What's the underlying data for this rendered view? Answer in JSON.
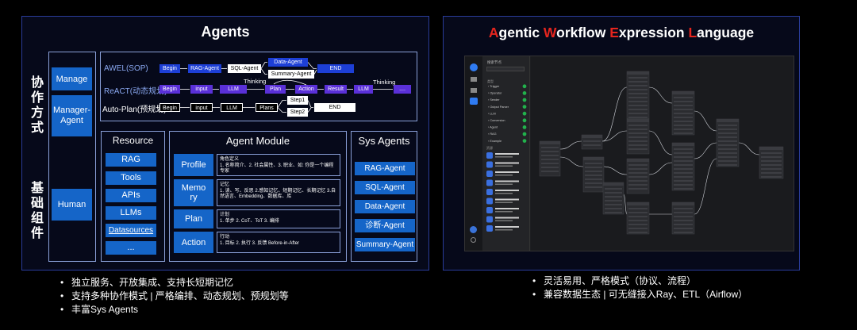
{
  "left": {
    "title": "Agents",
    "vertical_labels": {
      "collab": "协作方式",
      "base": "基础组件"
    },
    "collab_boxes": [
      "Manage",
      "Manager-Agent",
      "Human"
    ],
    "flows": {
      "awel": {
        "label": "AWEL(SOP)",
        "chips": [
          "Begin",
          "RAG-Agent",
          "SQL-Agent",
          "Data-Agent",
          "Summary-Agent",
          "END"
        ]
      },
      "react": {
        "label": "ReACT(动态规划)",
        "chips": [
          "Begin",
          "input",
          "LLM",
          "Plan",
          "Action",
          "Result",
          "LLM",
          "...."
        ],
        "thinking": "Thinking"
      },
      "autoplan": {
        "label": "Auto-Plan(预规划)",
        "chips": [
          "Begin",
          "input",
          "LLM",
          "Plans",
          "Step1",
          "Step2",
          "END"
        ]
      }
    },
    "resource": {
      "title": "Resource",
      "items": [
        "RAG",
        "Tools",
        "APIs",
        "LLMs",
        "Datasources",
        "..."
      ]
    },
    "agent_module": {
      "title": "Agent Module",
      "rows": [
        {
          "label": "Profile",
          "desc_title": "角色定义",
          "desc": "1. 名称简介、2. 社会属性、3. 职业、如: 你是一个编程专家"
        },
        {
          "label": "Memory",
          "desc_title": "记忆",
          "desc": "1. 读、写、反思 2.感知记忆、短期记忆、长期记忆 3.自然语言、Embedding、数据库、库"
        },
        {
          "label": "Plan",
          "desc_title": "计划",
          "desc": "1. 单步    2. CoT、ToT    3. 编排"
        },
        {
          "label": "Action",
          "desc_title": "行动",
          "desc": "1. 目标   2. 执行   3. 反馈 Before-in-After"
        }
      ]
    },
    "sys_agents": {
      "title": "Sys Agents",
      "items": [
        "RAG-Agent",
        "SQL-Agent",
        "Data-Agent",
        "诊断-Agent",
        "Summary-Agent"
      ]
    },
    "bullets": [
      "独立服务、开放集成、支持长短期记忆",
      "支持多种协作模式 | 严格编排、动态规划、预规划等",
      "丰富Sys Agents"
    ]
  },
  "right": {
    "title_parts": [
      {
        "text": "A",
        "accent": true
      },
      {
        "text": "gentic ",
        "accent": false
      },
      {
        "text": "W",
        "accent": true
      },
      {
        "text": "orkflow ",
        "accent": false
      },
      {
        "text": "E",
        "accent": true
      },
      {
        "text": "xpression ",
        "accent": false
      },
      {
        "text": "L",
        "accent": true
      },
      {
        "text": "anguage",
        "accent": false
      }
    ],
    "screenshot": {
      "search_label": "搜索节点",
      "list_items": [
        "Trigger",
        "Operator",
        "Sender",
        "Output Parser",
        "LLM",
        "Conversion",
        "Agent",
        "RAG",
        "Example"
      ],
      "section_label": "资源",
      "resource_items": [
        "Ollama Sender Stream",
        "Milvus 向量存储",
        "Weaviate 向量存储",
        "ChromaStore 向量存储",
        "TFS 向量存储"
      ]
    },
    "bullets": [
      "灵活易用、严格模式（协议、流程）",
      "兼容数据生态 | 可无缝接入Ray、ETL（Airflow）"
    ]
  },
  "colors": {
    "accent_red": "#e5251e",
    "blue_box": "#1565c8",
    "panel_border": "#2a3c9a"
  }
}
